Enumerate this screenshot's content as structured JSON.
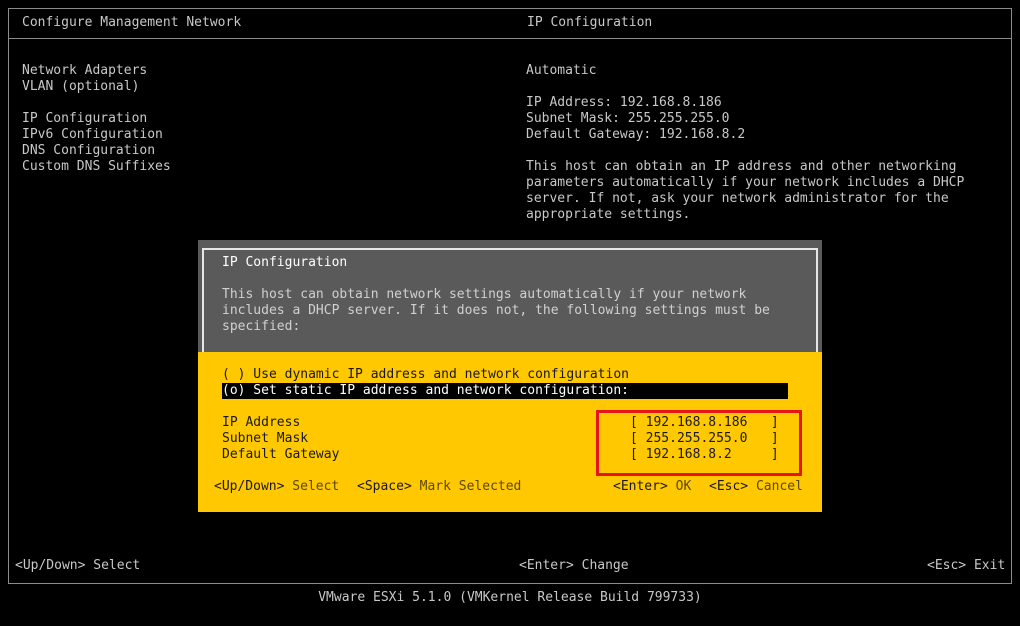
{
  "header": {
    "left_title": "Configure Management Network",
    "right_title": "IP Configuration"
  },
  "menu": {
    "items": [
      "Network Adapters",
      "VLAN (optional)",
      "IP Configuration",
      "IPv6 Configuration",
      "DNS Configuration",
      "Custom DNS Suffixes"
    ]
  },
  "info": {
    "mode": "Automatic",
    "ip_line": "IP Address: 192.168.8.186",
    "mask_line": "Subnet Mask: 255.255.255.0",
    "gateway_line": "Default Gateway: 192.168.8.2",
    "desc": [
      "This host can obtain an IP address and other networking",
      "parameters automatically if your network includes a DHCP",
      "server. If not, ask your network administrator for the",
      "appropriate settings."
    ]
  },
  "footer": {
    "left_key": "<Up/Down>",
    "left_action": "Select",
    "mid_key": "<Enter>",
    "mid_action": "Change",
    "right_key": "<Esc>",
    "right_action": "Exit",
    "version": "VMware ESXi 5.1.0 (VMKernel Release Build 799733)"
  },
  "dialog": {
    "title": "IP Configuration",
    "desc": [
      "This host can obtain network settings automatically if your network",
      "includes a DHCP server. If it does not, the following settings must be",
      "specified:"
    ],
    "option_dynamic": "( ) Use dynamic IP address and network configuration",
    "option_static": "(o) Set static IP address and network configuration:",
    "fields": {
      "ip_label": "IP Address",
      "ip_value": "[ 192.168.8.186   ]",
      "mask_label": "Subnet Mask",
      "mask_value": "[ 255.255.255.0   ]",
      "gw_label": "Default Gateway",
      "gw_value": "[ 192.168.8.2     ]"
    },
    "keys": {
      "updown": "<Up/Down>",
      "select": "Select",
      "space": "<Space>",
      "mark": "Mark Selected",
      "enter": "<Enter>",
      "ok": "OK",
      "esc": "<Esc>",
      "cancel": "Cancel"
    }
  },
  "colors": {
    "dialog_bg": "#ffc800",
    "dialog_header_bg": "#5a5a5a",
    "highlight": "#e8141c"
  }
}
